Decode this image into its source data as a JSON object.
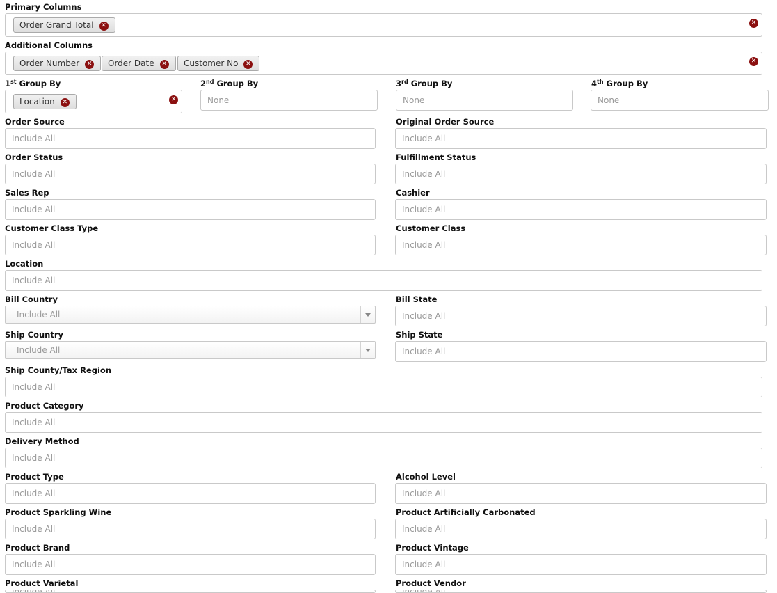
{
  "primary": {
    "label": "Primary Columns",
    "tags": [
      "Order Grand Total"
    ]
  },
  "additional": {
    "label": "Additional Columns",
    "tags": [
      "Order Number",
      "Order Date",
      "Customer No"
    ]
  },
  "group_by": {
    "g1": {
      "num": "1",
      "sup": "st",
      "rest": " Group By",
      "tag": "Location"
    },
    "g2": {
      "num": "2",
      "sup": "nd",
      "rest": " Group By",
      "placeholder": "None"
    },
    "g3": {
      "num": "3",
      "sup": "rd",
      "rest": " Group By",
      "placeholder": "None"
    },
    "g4": {
      "num": "4",
      "sup": "th",
      "rest": " Group By",
      "placeholder": "None"
    }
  },
  "filters": {
    "order_source": {
      "label": "Order Source",
      "placeholder": "Include All"
    },
    "original_order_source": {
      "label": "Original Order Source",
      "placeholder": "Include All"
    },
    "order_status": {
      "label": "Order Status",
      "placeholder": "Include All"
    },
    "fulfillment_status": {
      "label": "Fulfillment Status",
      "placeholder": "Include All"
    },
    "sales_rep": {
      "label": "Sales Rep",
      "placeholder": "Include All"
    },
    "cashier": {
      "label": "Cashier",
      "placeholder": "Include All"
    },
    "customer_class_type": {
      "label": "Customer Class Type",
      "placeholder": "Include All"
    },
    "customer_class": {
      "label": "Customer Class",
      "placeholder": "Include All"
    },
    "location": {
      "label": "Location",
      "placeholder": "Include All"
    },
    "bill_country": {
      "label": "Bill Country",
      "value": "Include All"
    },
    "bill_state": {
      "label": "Bill State",
      "placeholder": "Include All"
    },
    "ship_country": {
      "label": "Ship Country",
      "value": "Include All"
    },
    "ship_state": {
      "label": "Ship State",
      "placeholder": "Include All"
    },
    "ship_county": {
      "label": "Ship County/Tax Region",
      "placeholder": "Include All"
    },
    "product_category": {
      "label": "Product Category",
      "placeholder": "Include All"
    },
    "delivery_method": {
      "label": "Delivery Method",
      "placeholder": "Include All"
    },
    "product_type": {
      "label": "Product Type",
      "placeholder": "Include All"
    },
    "alcohol_level": {
      "label": "Alcohol Level",
      "placeholder": "Include All"
    },
    "product_sparkling_wine": {
      "label": "Product Sparkling Wine",
      "placeholder": "Include All"
    },
    "product_artificially_carbonated": {
      "label": "Product Artificially Carbonated",
      "placeholder": "Include All"
    },
    "product_brand": {
      "label": "Product Brand",
      "placeholder": "Include All"
    },
    "product_vintage": {
      "label": "Product Vintage",
      "placeholder": "Include All"
    },
    "product_varietal": {
      "label": "Product Varietal",
      "placeholder": "Include All"
    },
    "product_vendor": {
      "label": "Product Vendor",
      "placeholder": "Include All"
    }
  },
  "icons": {
    "remove": "x-circle-icon",
    "dropdown": "chevron-down-icon"
  },
  "colors": {
    "remove_icon": "#8b1010",
    "border": "#c9c9c9"
  }
}
